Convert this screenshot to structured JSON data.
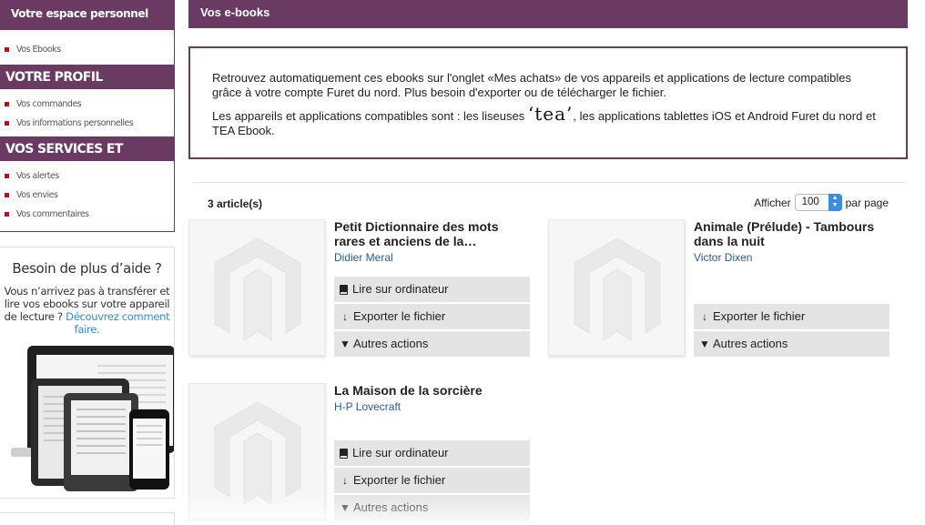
{
  "sidebar": {
    "account_title": "Votre espace personnel",
    "account_items": [
      {
        "label": "Vos Ebooks"
      }
    ],
    "profile_title": "VOTRE PROFIL",
    "profile_items": [
      {
        "label": "Vos commandes"
      },
      {
        "label": "Vos informations personnelles"
      }
    ],
    "services_title": "VOS SERVICES ET PRÉFÉRENCES",
    "services_items": [
      {
        "label": "Vos alertes"
      },
      {
        "label": "Vos envies"
      },
      {
        "label": "Vos commentaires"
      }
    ]
  },
  "help": {
    "title": "Besoin de plus d’aide ?",
    "text": "Vous n’arrivez pas à transférer et lire vos ebooks sur votre appareil de lecture ?",
    "link": "Découvrez comment faire."
  },
  "main": {
    "title": "Vos e-books",
    "info_line1": "Retrouvez automatiquement ces ebooks sur l'onglet «Mes achats» de vos appareils et applications de lecture compatibles grâce à votre compte Furet du nord. Plus besoin d'exporter ou de télécharger le fichier.",
    "info_line2_start": "Les appareils et applications compatibles sont : les liseuses",
    "tea_logo": "‘tea’",
    "info_line2_end": ", les applications tablettes iOS et Android Furet du nord et TEA Ebook.",
    "count": "3 article(s)",
    "show_label": "Afficher",
    "per_page_value": "100",
    "per_page_label": "par page"
  },
  "products": [
    {
      "title": "Petit Dictionnaire des mots rares et anciens de la…",
      "author": "Didier Meral",
      "read": "Lire sur ordinateur",
      "export": "Exporter le fichier",
      "more": "Autres actions"
    },
    {
      "title": "Animale (Prélude) - Tambours dans la nuit",
      "author": "Victor Dixen",
      "export": "Exporter le fichier",
      "more": "Autres actions"
    },
    {
      "title": "La Maison de la sorcière",
      "author": "H-P Lovecraft",
      "read": "Lire sur ordinateur",
      "export": "Exporter le fichier",
      "more": "Autres actions"
    }
  ],
  "colors": {
    "brand": "#6b3a63",
    "bullet": "#d0021b",
    "link": "#2b8fd6",
    "author": "#2a5a9a",
    "select_accent": "#3c8de0"
  },
  "icons": [
    "book-icon",
    "download-arrow-icon",
    "triangle-down-icon",
    "placeholder-logo-icon",
    "select-arrows-icon"
  ]
}
